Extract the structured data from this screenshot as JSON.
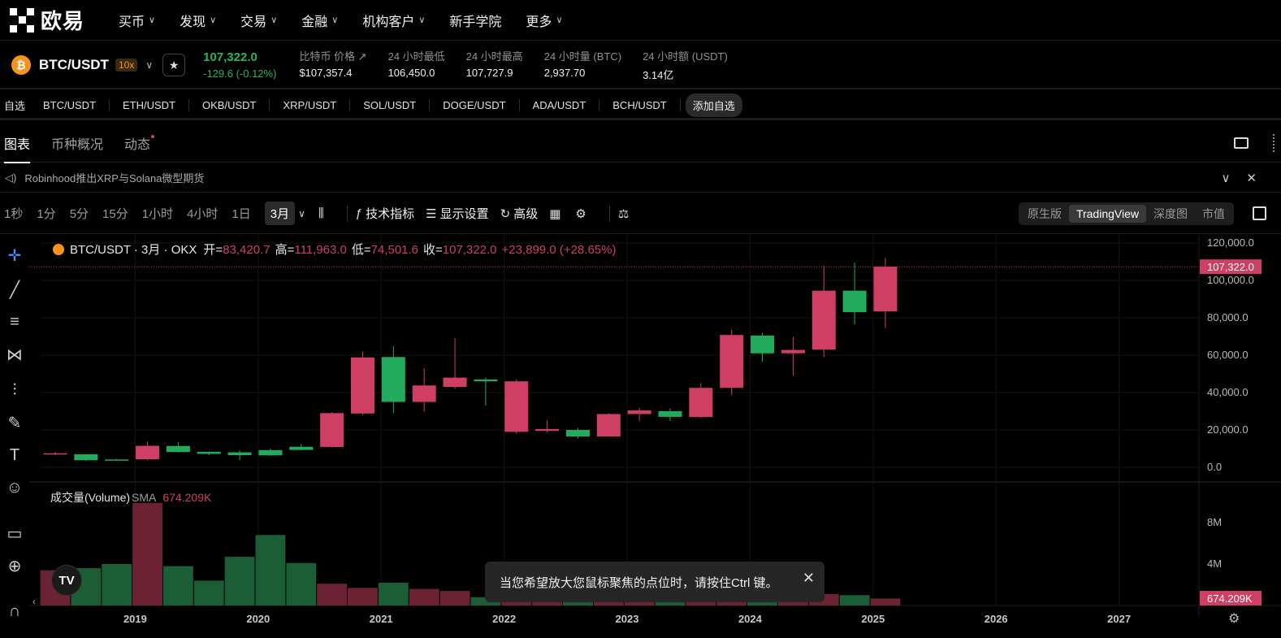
{
  "brand": {
    "logo_text": "欧易"
  },
  "nav": {
    "items": [
      {
        "label": "买币",
        "chevron": true
      },
      {
        "label": "发现",
        "chevron": true
      },
      {
        "label": "交易",
        "chevron": true
      },
      {
        "label": "金融",
        "chevron": true
      },
      {
        "label": "机构客户",
        "chevron": true
      },
      {
        "label": "新手学院",
        "chevron": false
      },
      {
        "label": "更多",
        "chevron": true
      }
    ]
  },
  "ticker": {
    "coin_glyph": "₿",
    "pair": "BTC/USDT",
    "leverage": "10x",
    "last_price": "107,322.0",
    "change": "-129.6 (-0.12%)",
    "stats": [
      {
        "label": "比特币 价格 ↗",
        "value": "$107,357.4"
      },
      {
        "label": "24 小时最低",
        "value": "106,450.0"
      },
      {
        "label": "24 小时最高",
        "value": "107,727.9"
      },
      {
        "label": "24 小时量 (BTC)",
        "value": "2,937.70"
      },
      {
        "label": "24 小时额 (USDT)",
        "value": "3.14亿"
      }
    ]
  },
  "favorites": {
    "label": "自选",
    "items": [
      "BTC/USDT",
      "ETH/USDT",
      "OKB/USDT",
      "XRP/USDT",
      "SOL/USDT",
      "DOGE/USDT",
      "ADA/USDT",
      "BCH/USDT"
    ],
    "add_label": "添加自选"
  },
  "tabs": [
    {
      "label": "图表"
    },
    {
      "label": "币种概况"
    },
    {
      "label": "动态"
    }
  ],
  "news": {
    "text": "Robinhood推出XRP与Solana微型期货"
  },
  "toolbar": {
    "timeframes": [
      "1秒",
      "1分",
      "5分",
      "15分",
      "1小时",
      "4小时",
      "1日"
    ],
    "active_timeframe": "3月",
    "indicators_label": "技术指标",
    "display_label": "显示设置",
    "advanced_label": "高级",
    "views": [
      "原生版",
      "TradingView",
      "深度图",
      "市值"
    ],
    "active_view": "TradingView"
  },
  "legend": {
    "title": "BTC/USDT · 3月 · OKX",
    "open_label": "开=",
    "open": "83,420.7",
    "high_label": "高=",
    "high": "111,963.0",
    "low_label": "低=",
    "low": "74,501.6",
    "close_label": "收=",
    "close": "107,322.0",
    "change": "+23,899.0 (+28.65%)"
  },
  "volume_legend": {
    "title": "成交量(Volume)",
    "sma_label": "SMA",
    "sma_value": "674.209K"
  },
  "toast": {
    "text": "当您希望放大您鼠标聚焦的点位时，请按住Ctrl 键。"
  },
  "colors": {
    "up": "#22ab5c",
    "down": "#cf3e63",
    "up_vol": "#1b5e35",
    "down_vol": "#6b2233"
  },
  "chart_data": {
    "type": "candlestick",
    "interval": "3月",
    "price_axis": {
      "ticks": [
        0,
        20000,
        40000,
        60000,
        80000,
        100000,
        120000
      ],
      "labels": [
        "0.0",
        "20,000.0",
        "40,000.0",
        "60,000.0",
        "80,000.0",
        "100,000.0",
        "120,000.0"
      ],
      "current_label": "107,322.0",
      "current": 107322
    },
    "volume_axis": {
      "ticks": [
        4000000,
        8000000
      ],
      "labels": [
        "4M",
        "8M"
      ],
      "current_label": "674.209K",
      "current": 674209
    },
    "x_labels": [
      "2019",
      "2020",
      "2021",
      "2022",
      "2023",
      "2024",
      "2025",
      "2026",
      "2027"
    ],
    "candles": [
      {
        "o": 7500,
        "h": 8200,
        "l": 6500,
        "c": 7200,
        "v": 3400000
      },
      {
        "o": 3800,
        "h": 4300,
        "l": 3400,
        "c": 7000,
        "v": 3600000
      },
      {
        "o": 4000,
        "h": 4500,
        "l": 3600,
        "c": 4200,
        "v": 4000000
      },
      {
        "o": 11500,
        "h": 13800,
        "l": 3800,
        "c": 4300,
        "v": 9900000
      },
      {
        "o": 8200,
        "h": 13500,
        "l": 8000,
        "c": 11400,
        "v": 3800000
      },
      {
        "o": 7200,
        "h": 8500,
        "l": 6500,
        "c": 8300,
        "v": 2400000
      },
      {
        "o": 6500,
        "h": 9000,
        "l": 3800,
        "c": 8000,
        "v": 4700000
      },
      {
        "o": 6400,
        "h": 10000,
        "l": 6200,
        "c": 9200,
        "v": 6800000
      },
      {
        "o": 9300,
        "h": 12500,
        "l": 9000,
        "c": 11000,
        "v": 4100000
      },
      {
        "o": 29000,
        "h": 29500,
        "l": 10600,
        "c": 10900,
        "v": 2100000
      },
      {
        "o": 58800,
        "h": 61800,
        "l": 28000,
        "c": 28800,
        "v": 1700000
      },
      {
        "o": 35000,
        "h": 64800,
        "l": 29000,
        "c": 59000,
        "v": 2200000
      },
      {
        "o": 43800,
        "h": 53000,
        "l": 29800,
        "c": 35000,
        "v": 1600000
      },
      {
        "o": 48000,
        "h": 69000,
        "l": 42000,
        "c": 43000,
        "v": 1400000
      },
      {
        "o": 46000,
        "h": 48000,
        "l": 33000,
        "c": 47000,
        "v": 800000
      },
      {
        "o": 46000,
        "h": 47000,
        "l": 18000,
        "c": 19000,
        "v": 1200000
      },
      {
        "o": 20500,
        "h": 25000,
        "l": 18600,
        "c": 19500,
        "v": 1000000
      },
      {
        "o": 16500,
        "h": 21000,
        "l": 15500,
        "c": 20000,
        "v": 800000
      },
      {
        "o": 28500,
        "h": 29000,
        "l": 16500,
        "c": 16500,
        "v": 700000
      },
      {
        "o": 30500,
        "h": 31800,
        "l": 24800,
        "c": 28500,
        "v": 600000
      },
      {
        "o": 27000,
        "h": 31500,
        "l": 24800,
        "c": 30000,
        "v": 600000
      },
      {
        "o": 42500,
        "h": 45000,
        "l": 26500,
        "c": 26900,
        "v": 800000
      },
      {
        "o": 70800,
        "h": 73800,
        "l": 38500,
        "c": 42500,
        "v": 1100000
      },
      {
        "o": 61000,
        "h": 72000,
        "l": 56500,
        "c": 70500,
        "v": 800000
      },
      {
        "o": 62800,
        "h": 70000,
        "l": 49000,
        "c": 61000,
        "v": 700000
      },
      {
        "o": 94500,
        "h": 108000,
        "l": 59000,
        "c": 63000,
        "v": 1100000
      },
      {
        "o": 83000,
        "h": 109500,
        "l": 76500,
        "c": 94500,
        "v": 1000000
      },
      {
        "o": 107322,
        "h": 111963,
        "l": 74501.6,
        "c": 83420.7,
        "v": 674209
      }
    ]
  }
}
